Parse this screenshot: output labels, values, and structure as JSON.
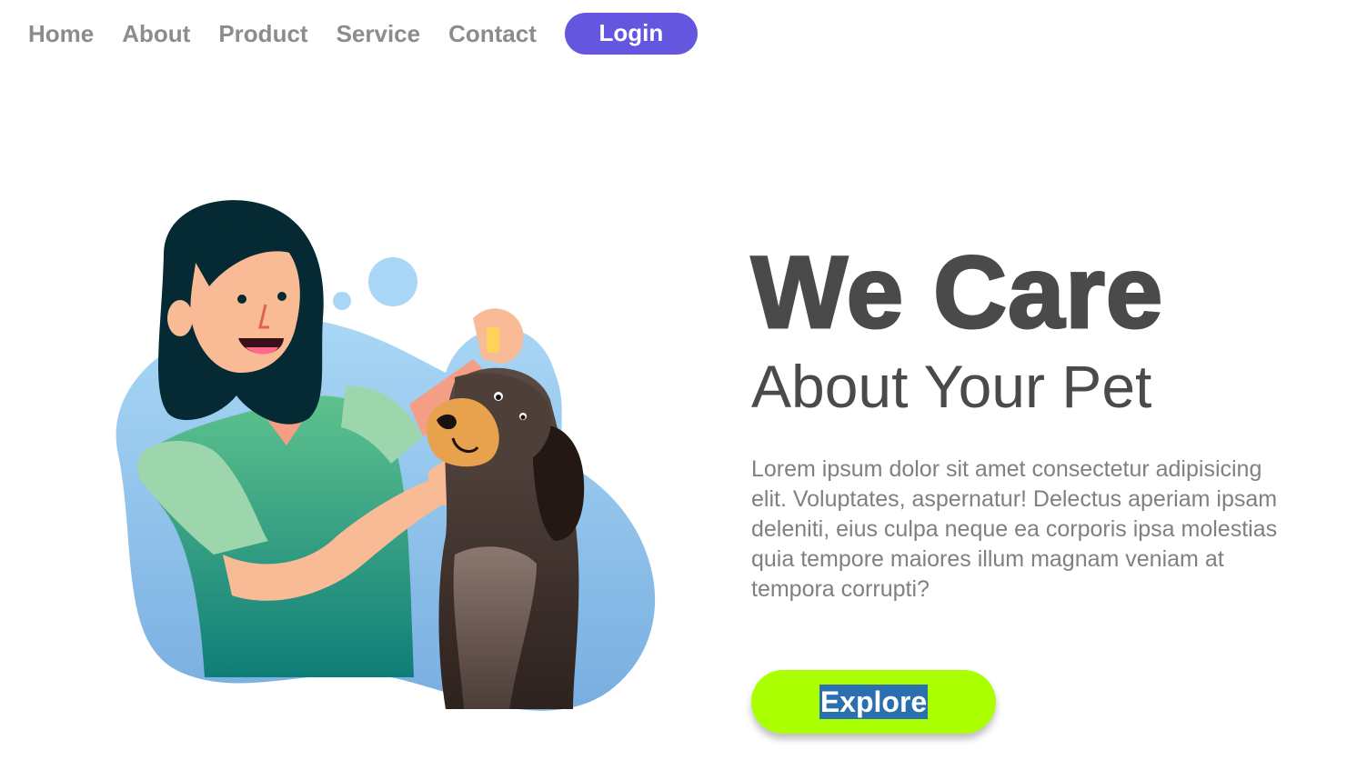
{
  "nav": {
    "items": [
      {
        "label": "Home"
      },
      {
        "label": "About"
      },
      {
        "label": "Product"
      },
      {
        "label": "Service"
      },
      {
        "label": "Contact"
      }
    ],
    "login_label": "Login"
  },
  "hero": {
    "title": "We Care",
    "subtitle": "About Your Pet",
    "body": "Lorem ipsum dolor sit amet consectetur adipisicing elit. Voluptates, aspernatur! Delectus aperiam ipsam deleniti, eius culpa neque ea corporis ipsa molestias quia tempore maiores illum magnam veniam at tempora corrupti?",
    "cta_label": "Explore"
  },
  "colors": {
    "nav_text": "#8c8c8c",
    "login_bg": "#6556e0",
    "heading": "#4a4a4a",
    "body_text": "#808080",
    "cta_bg": "#aaff00",
    "cta_text_highlight": "#2a6fb0",
    "blob_blue": "#8fc5ec"
  }
}
